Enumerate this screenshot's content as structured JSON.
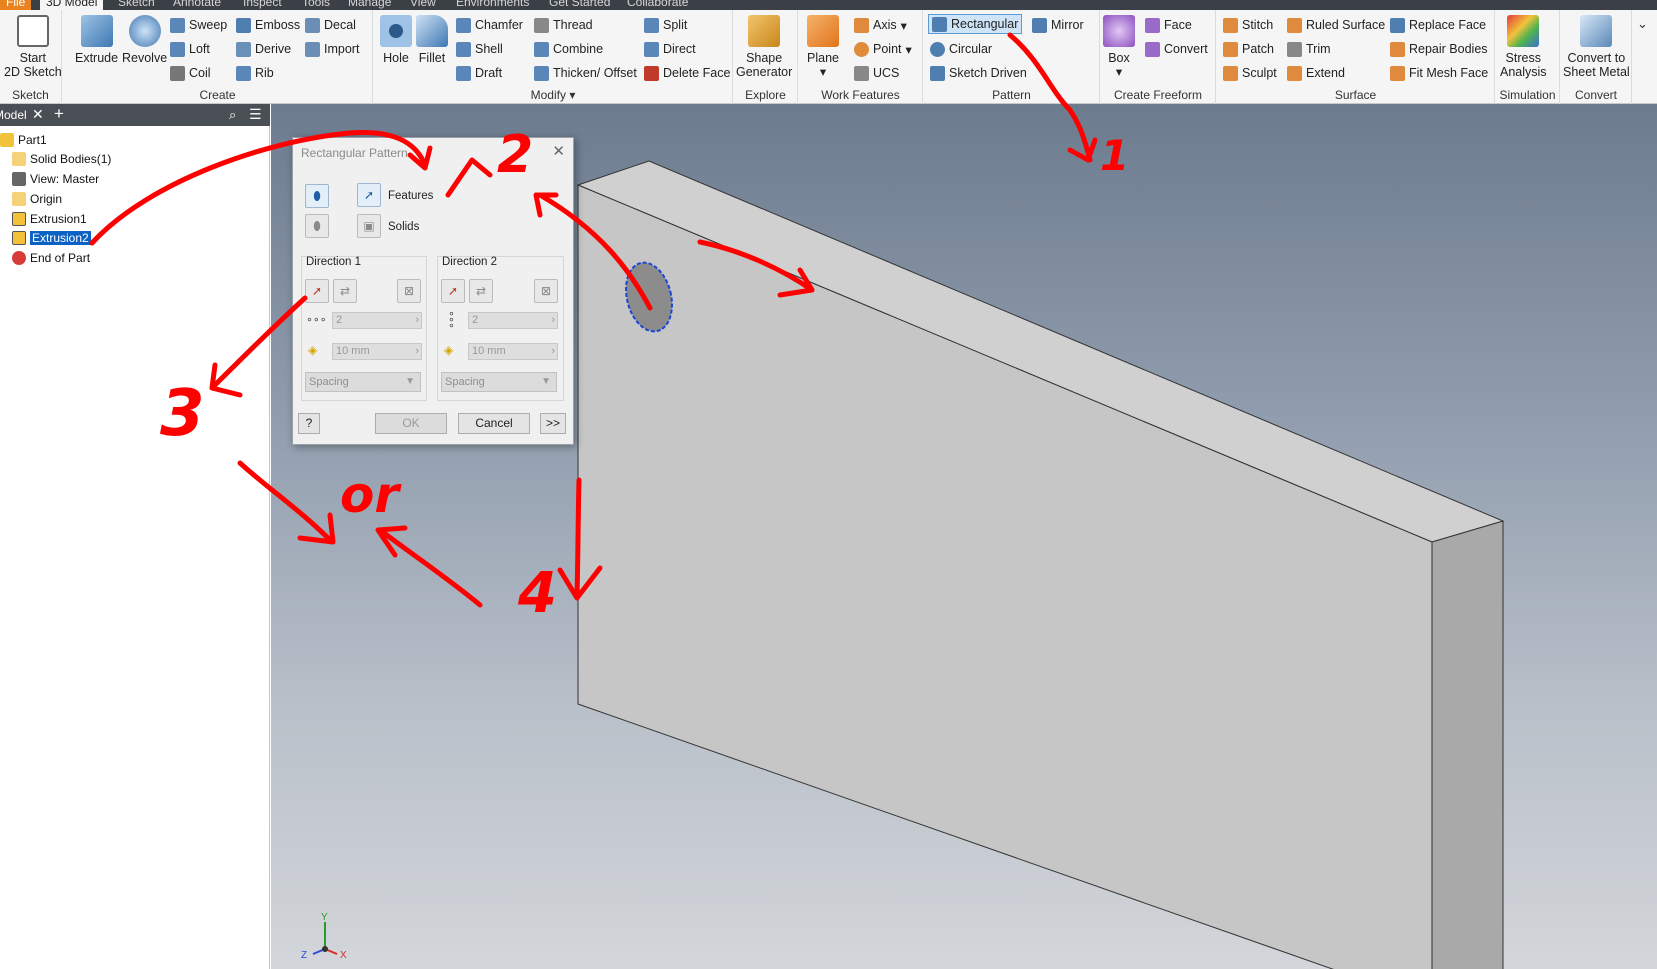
{
  "menu_tabs": [
    "File",
    "3D Model",
    "Sketch",
    "Annotate",
    "Inspect",
    "Tools",
    "Manage",
    "View",
    "Environments",
    "Get Started",
    "Collaborate"
  ],
  "ribbon": {
    "sketch": {
      "title": "Sketch",
      "start_line1": "Start",
      "start_line2": "2D Sketch"
    },
    "create": {
      "title": "Create",
      "extrude": "Extrude",
      "revolve": "Revolve",
      "sweep": "Sweep",
      "loft": "Loft",
      "coil": "Coil",
      "emboss": "Emboss",
      "derive": "Derive",
      "rib": "Rib",
      "decal": "Decal",
      "import": "Import"
    },
    "modify": {
      "title": "Modify",
      "hole": "Hole",
      "fillet": "Fillet",
      "chamfer": "Chamfer",
      "shell": "Shell",
      "draft": "Draft",
      "thread": "Thread",
      "combine": "Combine",
      "thicken": "Thicken/ Offset",
      "split": "Split",
      "direct": "Direct",
      "delete_face": "Delete Face"
    },
    "explore": {
      "title": "Explore",
      "shape_line1": "Shape",
      "shape_line2": "Generator"
    },
    "work_features": {
      "title": "Work Features",
      "plane": "Plane",
      "axis": "Axis",
      "point": "Point",
      "ucs": "UCS"
    },
    "pattern": {
      "title": "Pattern",
      "rectangular": "Rectangular",
      "circular": "Circular",
      "sketch_driven": "Sketch Driven",
      "mirror": "Mirror"
    },
    "create_freeform": {
      "title": "Create Freeform",
      "box": "Box",
      "face": "Face",
      "convert": "Convert"
    },
    "surface": {
      "title": "Surface",
      "stitch": "Stitch",
      "patch": "Patch",
      "sculpt": "Sculpt",
      "ruled_surface": "Ruled Surface",
      "trim": "Trim",
      "extend": "Extend",
      "replace_face": "Replace Face",
      "repair_bodies": "Repair Bodies",
      "fit_mesh_face": "Fit Mesh Face"
    },
    "simulation": {
      "title": "Simulation",
      "stress_line1": "Stress",
      "stress_line2": "Analysis"
    },
    "convert": {
      "title": "Convert",
      "sheet_line1": "Convert to",
      "sheet_line2": "Sheet Metal"
    }
  },
  "browser": {
    "tab": "Model",
    "tree": [
      "Part1",
      "Solid Bodies(1)",
      "View: Master",
      "Origin",
      "Extrusion1",
      "Extrusion2",
      "End of Part"
    ]
  },
  "dialog": {
    "title": "Rectangular Pattern",
    "features": "Features",
    "solids": "Solids",
    "direction1": "Direction 1",
    "direction2": "Direction 2",
    "d1_count": "2",
    "d1_spacing": "10 mm",
    "d1_method": "Spacing",
    "d2_count": "2",
    "d2_spacing": "10 mm",
    "d2_method": "Spacing",
    "ok": "OK",
    "cancel": "Cancel",
    "more": ">>",
    "help": "?"
  },
  "annotations": [
    "1",
    "2",
    "3",
    "or",
    "4"
  ],
  "triad": {
    "y": "Y",
    "x": "X",
    "z": "Z"
  },
  "colors": {
    "annotation": "#ff0000",
    "ribbon_bg": "#f5f5f5",
    "selection": "#0b62c4",
    "active_ribbon": "#cfe4f7"
  }
}
